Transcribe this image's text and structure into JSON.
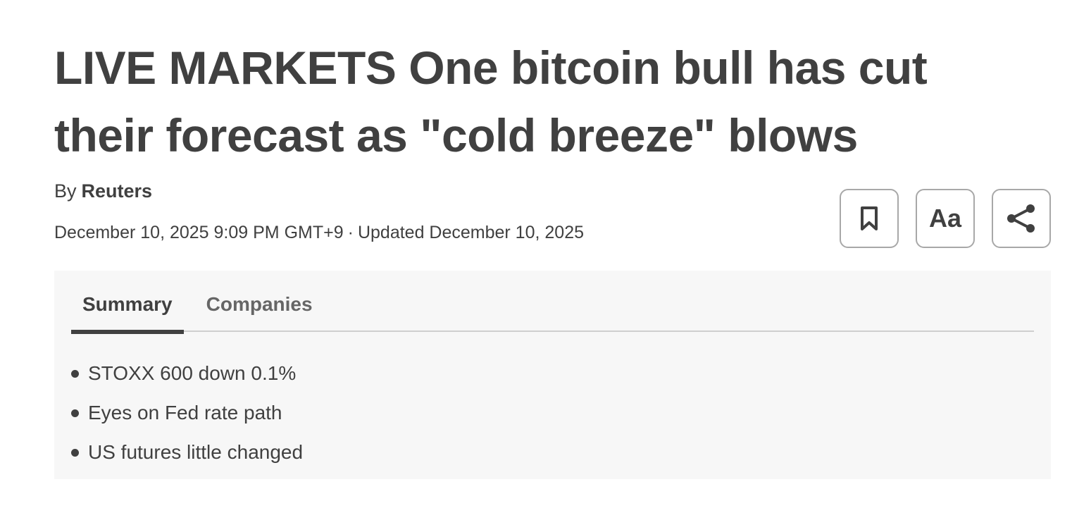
{
  "article": {
    "headline": "LIVE MARKETS One bitcoin bull has cut their forecast as \"cold breeze\" blows",
    "byline_prefix": "By",
    "author": "Reuters",
    "published": "December 10, 2025 9:09 PM GMT+9",
    "separator": "·",
    "updated": "Updated December 10, 2025"
  },
  "tools": {
    "bookmark_icon": "bookmark-icon",
    "text_size_label": "Aa",
    "share_icon": "share-icon"
  },
  "summary": {
    "tabs": [
      {
        "label": "Summary",
        "active": true
      },
      {
        "label": "Companies",
        "active": false
      }
    ],
    "bullets": [
      "STOXX 600 down 0.1%",
      "Eyes on Fed rate path",
      "US futures little changed"
    ]
  },
  "colors": {
    "text": "#404040",
    "panel_bg": "#f7f7f7",
    "border": "#a8a8a8"
  }
}
